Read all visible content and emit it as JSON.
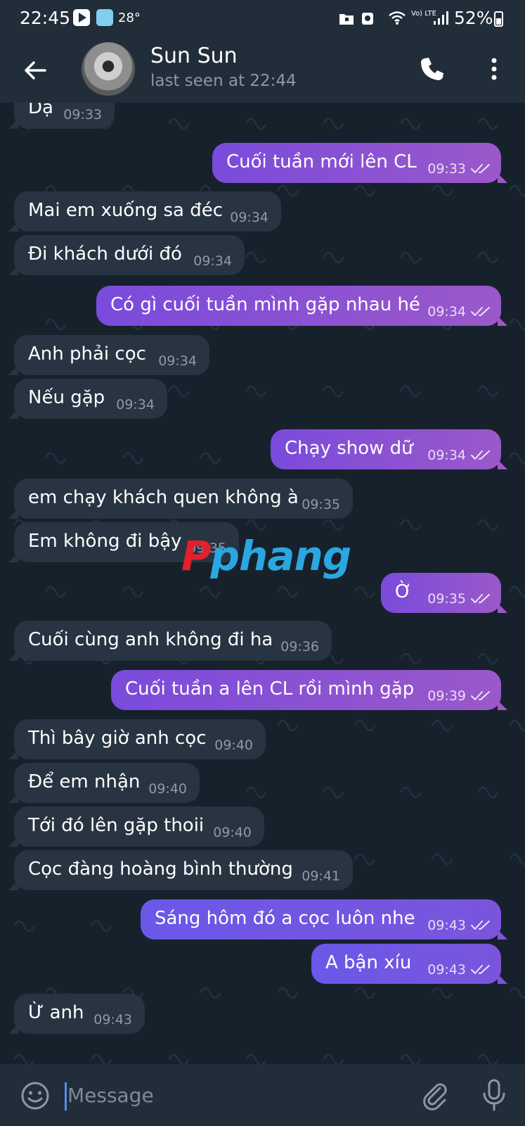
{
  "status_bar": {
    "time": "22:45",
    "temperature": "28°",
    "network_label": "Vo) LTE",
    "battery": "52%"
  },
  "header": {
    "contact_name": "Sun Sun",
    "last_seen": "last seen at 22:44"
  },
  "messages": [
    {
      "dir": "in",
      "text": "Dạ",
      "time": "09:33"
    },
    {
      "dir": "out",
      "text": "Cuối tuần mới lên CL",
      "time": "09:33"
    },
    {
      "dir": "in",
      "text": "Mai em xuống sa đéc",
      "time": "09:34"
    },
    {
      "dir": "in",
      "text": "Đi khách dưới đó",
      "time": "09:34"
    },
    {
      "dir": "out",
      "text": "Có gì cuối tuần mình gặp nhau hé",
      "time": "09:34"
    },
    {
      "dir": "in",
      "text": "Anh phải cọc",
      "time": "09:34"
    },
    {
      "dir": "in",
      "text": "Nếu gặp",
      "time": "09:34"
    },
    {
      "dir": "out",
      "text": "Chạy show dữ",
      "time": "09:34"
    },
    {
      "dir": "in",
      "text": "em chạy khách quen không à",
      "time": "09:35"
    },
    {
      "dir": "in",
      "text": "Em không đi bậy",
      "time": "09:35"
    },
    {
      "dir": "out",
      "text": "Ờ",
      "time": "09:35"
    },
    {
      "dir": "in",
      "text": "Cuối cùng anh không đi ha",
      "time": "09:36"
    },
    {
      "dir": "out",
      "text": "Cuối tuần a lên CL rồi mình gặp",
      "time": "09:39"
    },
    {
      "dir": "in",
      "text": "Thì bây giờ anh cọc",
      "time": "09:40"
    },
    {
      "dir": "in",
      "text": "Để em nhận",
      "time": "09:40"
    },
    {
      "dir": "in",
      "text": "Tới đó lên gặp thoii",
      "time": "09:40"
    },
    {
      "dir": "in",
      "text": "Cọc đàng hoàng bình thường",
      "time": "09:41"
    },
    {
      "dir": "out",
      "text": "Sáng hôm đó a cọc luôn nhe",
      "time": "09:43"
    },
    {
      "dir": "out",
      "text": "A bận xíu",
      "time": "09:43"
    },
    {
      "dir": "in",
      "text": "Ừ anh",
      "time": "09:43"
    }
  ],
  "watermark": {
    "prefix": "P",
    "rest": "phang"
  },
  "input": {
    "placeholder": "Message"
  },
  "colors": {
    "header_bg": "#222d3a",
    "incoming_bubble": "#283441",
    "outgoing_bubble_start": "#7a4bdc",
    "outgoing_bubble_end": "#9b58c9",
    "accent_caret": "#4f8ff0"
  }
}
